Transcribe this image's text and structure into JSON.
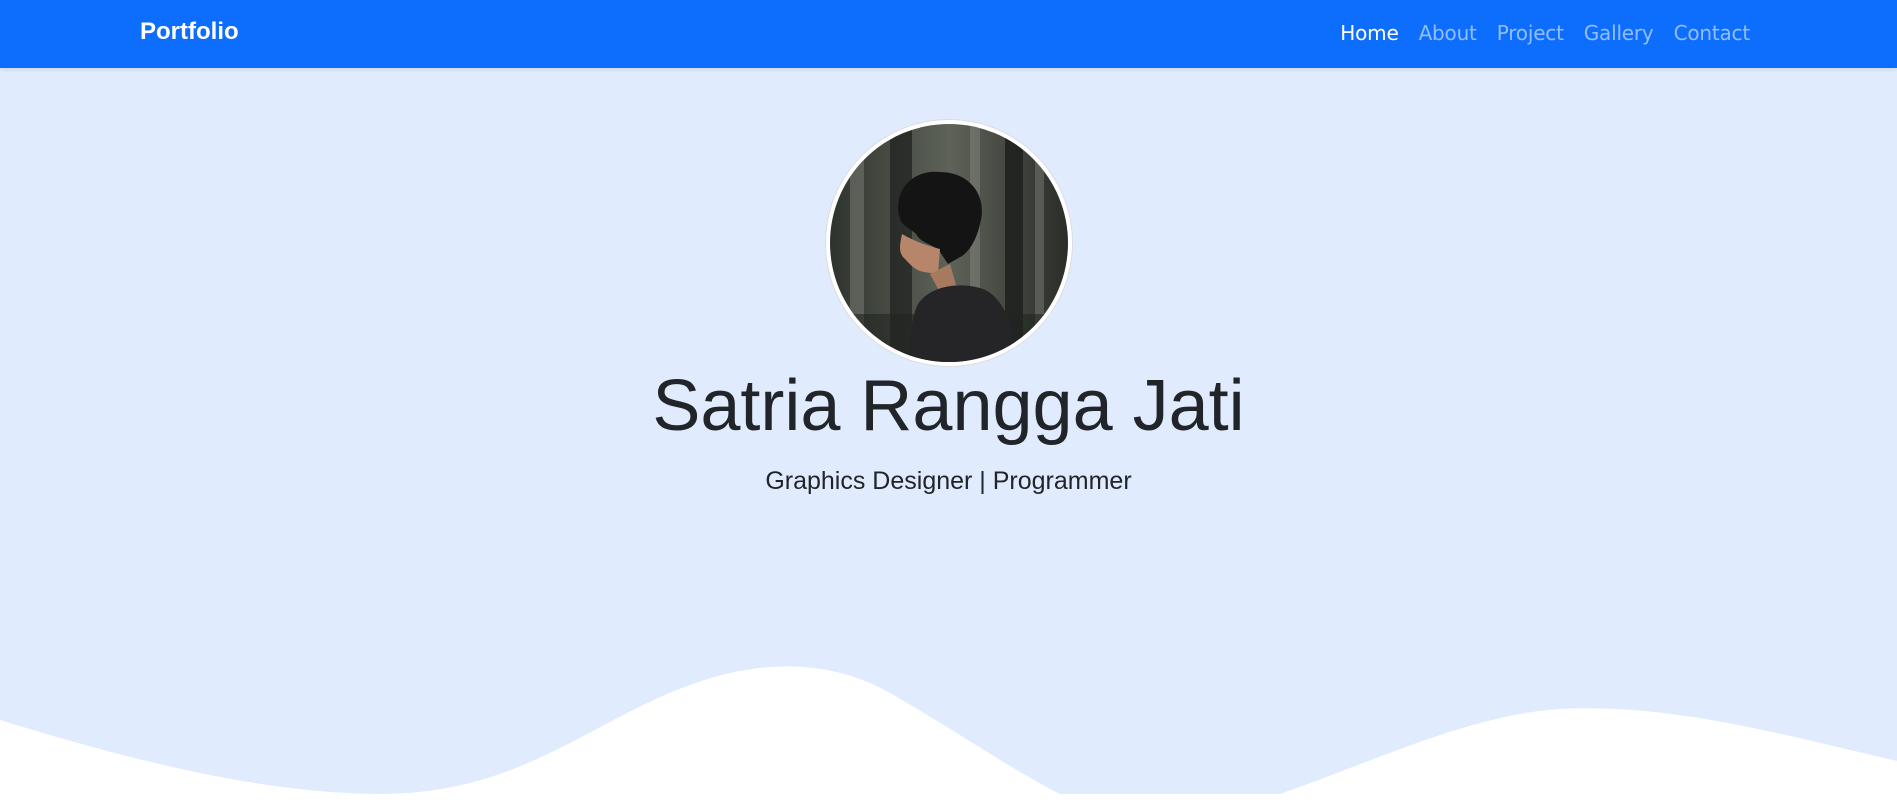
{
  "navbar": {
    "brand": "Portfolio",
    "links": [
      {
        "label": "Home",
        "active": true
      },
      {
        "label": "About",
        "active": false
      },
      {
        "label": "Project",
        "active": false
      },
      {
        "label": "Gallery",
        "active": false
      },
      {
        "label": "Contact",
        "active": false
      }
    ]
  },
  "hero": {
    "name": "Satria Rangga Jati",
    "tagline": "Graphics Designer | Programmer",
    "avatar": "profile-photo"
  },
  "colors": {
    "navbar_bg": "#0d6efd",
    "hero_bg": "#e0ecfe",
    "wave": "#ffffff",
    "text": "#212529"
  }
}
